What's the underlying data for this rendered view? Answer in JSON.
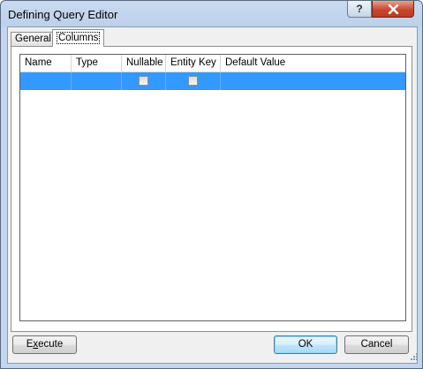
{
  "window": {
    "title": "Defining Query Editor"
  },
  "titlebar_buttons": {
    "help_label": "?"
  },
  "tabs": [
    {
      "label": "General",
      "selected": false
    },
    {
      "label": "Columns",
      "selected": true
    }
  ],
  "grid": {
    "columns": [
      "Name",
      "Type",
      "Nullable",
      "Entity Key",
      "Default Value"
    ],
    "rows": [
      {
        "name": "",
        "type": "",
        "nullable": false,
        "entity_key": false,
        "default_value": "",
        "selected": true
      }
    ],
    "selection_color": "#3399ff"
  },
  "buttons": {
    "execute_prefix": "E",
    "execute_mnemonic": "x",
    "execute_suffix": "ecute",
    "ok_label": "OK",
    "cancel_label": "Cancel"
  }
}
